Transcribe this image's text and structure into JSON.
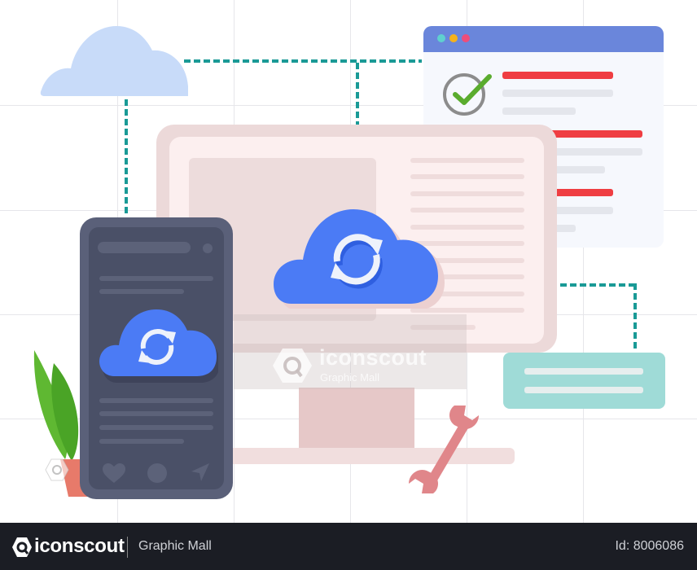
{
  "illustration": {
    "title": "Cloud sync across devices",
    "colors": {
      "accent_blue": "#4b7bf5",
      "light_cloud": "#c8dbf9",
      "connector_teal": "#1a9a96",
      "browser_header": "#6a86db",
      "alert_red": "#ef3e42",
      "check_green": "#5aac2e",
      "phone_body": "#4a5067",
      "note_teal": "#9fdbd7",
      "wrench": "#e0868a",
      "plant_green": "#5fb832",
      "pot": "#e77a6a"
    },
    "icons": {
      "top_cloud": "cloud-icon",
      "main_cloud": "cloud-sync-icon",
      "phone_cloud": "cloud-sync-icon",
      "checkmark": "check-circle-icon",
      "wrench": "wrench-icon",
      "plant": "plant-icon",
      "phone_actions": [
        "heart-icon",
        "circle-icon",
        "send-icon"
      ]
    }
  },
  "watermark": {
    "brand": "iconscout",
    "subtitle": "Graphic Mall"
  },
  "footer": {
    "brand": "iconscout",
    "subtitle": "Graphic Mall",
    "id_label": "Id: 8006086"
  }
}
